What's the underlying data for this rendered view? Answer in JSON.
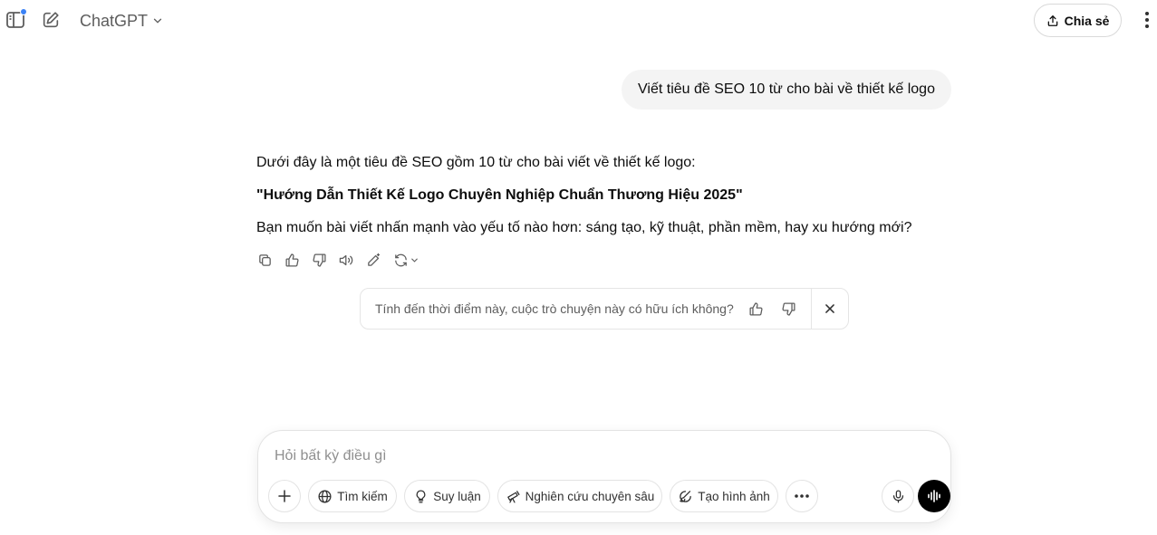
{
  "header": {
    "model_label": "ChatGPT",
    "share_label": "Chia sẻ"
  },
  "conversation": {
    "user_message": "Viết tiêu đề SEO 10 từ cho bài về thiết kế logo",
    "assistant": {
      "intro": "Dưới đây là một tiêu đề SEO gồm 10 từ cho bài viết về thiết kế logo:",
      "title": "\"Hướng Dẫn Thiết Kế Logo Chuyên Nghiệp Chuẩn Thương Hiệu 2025\"",
      "followup": "Bạn muốn bài viết nhấn mạnh vào yếu tố nào hơn: sáng tạo, kỹ thuật, phần mềm, hay xu hướng mới?"
    },
    "actions": [
      "copy-icon",
      "thumbs-up-icon",
      "thumbs-down-icon",
      "read-aloud-icon",
      "edit-icon",
      "regenerate-icon"
    ]
  },
  "feedback": {
    "question": "Tính đến thời điểm này, cuộc trò chuyện này có hữu ích không?"
  },
  "composer": {
    "placeholder": "Hỏi bất kỳ điều gì",
    "tools": {
      "search": "Tìm kiếm",
      "reason": "Suy luận",
      "deep_research": "Nghiên cứu chuyên sâu",
      "create_image": "Tạo hình ảnh"
    }
  },
  "colors": {
    "accent_dot": "#3b82f6",
    "bubble": "#f4f4f4",
    "voice_button": "#000000"
  }
}
